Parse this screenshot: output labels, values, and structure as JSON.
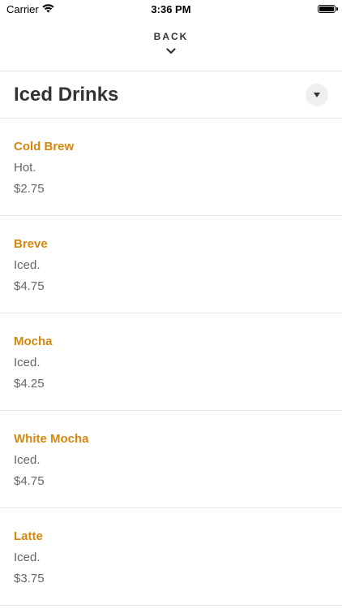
{
  "status_bar": {
    "carrier": "Carrier",
    "time": "3:36 PM"
  },
  "nav": {
    "back_label": "BACK"
  },
  "header": {
    "title": "Iced Drinks"
  },
  "items": [
    {
      "name": "Cold Brew",
      "description": "Hot.",
      "price": "$2.75"
    },
    {
      "name": "Breve",
      "description": "Iced.",
      "price": "$4.75"
    },
    {
      "name": "Mocha",
      "description": "Iced.",
      "price": "$4.25"
    },
    {
      "name": "White Mocha",
      "description": "Iced.",
      "price": "$4.75"
    },
    {
      "name": "Latte",
      "description": "Iced.",
      "price": "$3.75"
    }
  ],
  "colors": {
    "accent": "#d4870e",
    "divider": "#e6e6e6"
  }
}
